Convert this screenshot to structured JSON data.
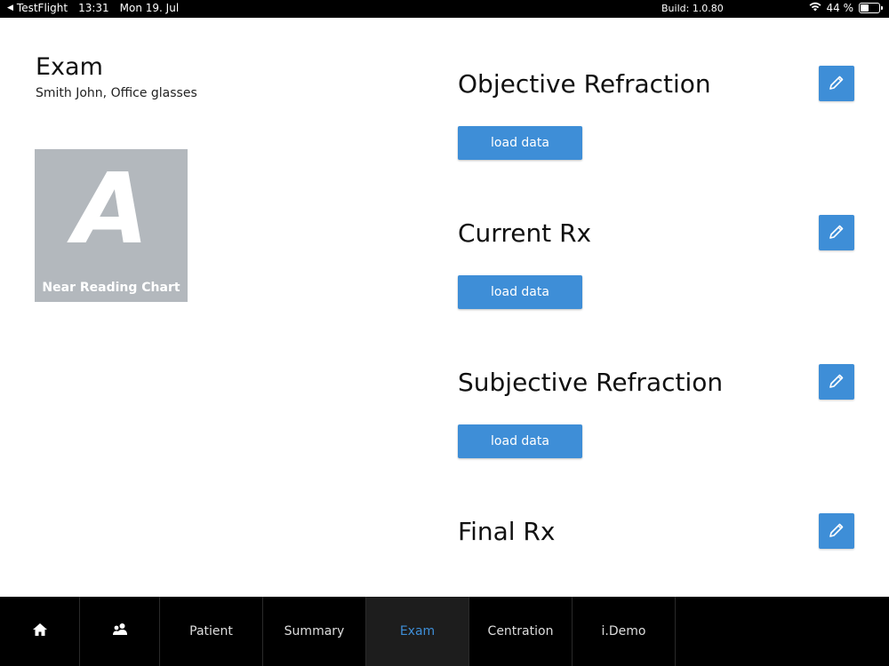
{
  "status_bar": {
    "back_app": "TestFlight",
    "time": "13:31",
    "date": "Mon 19. Jul",
    "build": "Build: 1.0.80",
    "battery": "44 %",
    "battery_level": 0.44
  },
  "header": {
    "title": "Exam",
    "subtitle": "Smith John, Office glasses"
  },
  "chart_tile": {
    "letter": "A",
    "label": "Near Reading Chart"
  },
  "sections": [
    {
      "title": "Objective Refraction",
      "load_label": "load data"
    },
    {
      "title": "Current Rx",
      "load_label": "load data"
    },
    {
      "title": "Subjective Refraction",
      "load_label": "load data"
    },
    {
      "title": "Final Rx"
    }
  ],
  "tabs": {
    "home_icon": "home-icon",
    "users_icon": "users-icon",
    "patient": "Patient",
    "summary": "Summary",
    "exam": "Exam",
    "centration": "Centration",
    "idemo": "i.Demo"
  },
  "colors": {
    "accent": "#3e8ed7",
    "tile_gray": "#b3b8bd"
  }
}
